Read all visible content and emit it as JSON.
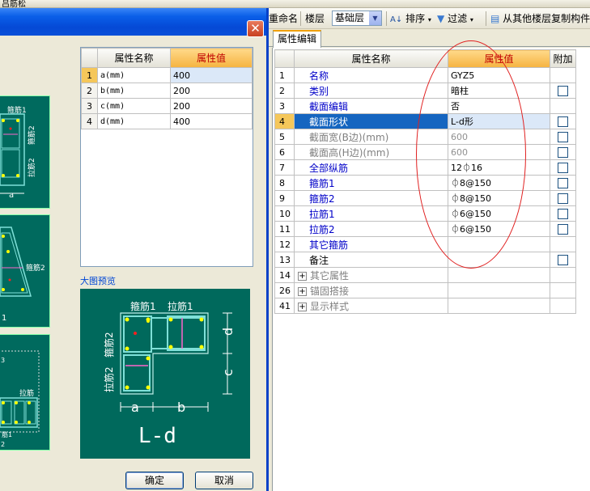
{
  "top_strip": {
    "left_text": "吕筋松"
  },
  "dialog": {
    "close_glyph": "✕",
    "thumbs": {
      "t1": {
        "label_a": "箍筋1",
        "label_b": "箍筋2",
        "label_c": "拉筋2",
        "label_d": "a"
      },
      "t2": {
        "label_a": "箍筋2",
        "label_b": "1"
      },
      "t3": {
        "label_a": "拉筋",
        "label_b": "3",
        "label_c": "筋1",
        "label_d": "2"
      }
    },
    "param_table": {
      "header": {
        "name": "属性名称",
        "value": "属性值"
      },
      "rows": [
        {
          "no": "1",
          "name": "a(mm)",
          "value": "400"
        },
        {
          "no": "2",
          "name": "b(mm)",
          "value": "200"
        },
        {
          "no": "3",
          "name": "c(mm)",
          "value": "200"
        },
        {
          "no": "4",
          "name": "d(mm)",
          "value": "400"
        }
      ]
    },
    "preview": {
      "label": "大图预览",
      "stirrup1": "箍筋1",
      "tie1": "拉筋1",
      "stirrup2": "箍筋2",
      "tie2": "拉筋2",
      "dim_a": "a",
      "dim_b": "b",
      "dim_c": "c",
      "dim_d": "d",
      "shape_name": "L-d"
    },
    "ok_label": "确定",
    "cancel_label": "取消"
  },
  "toolbar": {
    "rename": "重命名",
    "floor": "楼层",
    "floor_value": "基础层",
    "sort": "排序",
    "filter": "过滤",
    "copy_from_floor": "从其他楼层复制构件"
  },
  "tab": {
    "label": "属性编辑"
  },
  "prop_table": {
    "header": {
      "name": "属性名称",
      "value": "属性值",
      "attach": "附加"
    },
    "rows": [
      {
        "no": "1",
        "name": "名称",
        "value": "GYZ5",
        "check": false,
        "style": "blue"
      },
      {
        "no": "2",
        "name": "类别",
        "value": "暗柱",
        "check": true,
        "style": "blue"
      },
      {
        "no": "3",
        "name": "截面编辑",
        "value": "否",
        "check": false,
        "style": "blue"
      },
      {
        "no": "4",
        "name": "截面形状",
        "value": "L-d形",
        "check": true,
        "style": "blue"
      },
      {
        "no": "5",
        "name": "截面宽(B边)(mm)",
        "value": "600",
        "check": true,
        "style": "gray"
      },
      {
        "no": "6",
        "name": "截面高(H边)(mm)",
        "value": "600",
        "check": true,
        "style": "gray"
      },
      {
        "no": "7",
        "name": "全部纵筋",
        "value": "12⏀16",
        "check": true,
        "style": "blue"
      },
      {
        "no": "8",
        "name": "箍筋1",
        "value": "⏀8@150",
        "check": true,
        "style": "blue"
      },
      {
        "no": "9",
        "name": "箍筋2",
        "value": "⏀8@150",
        "check": true,
        "style": "blue"
      },
      {
        "no": "10",
        "name": "拉筋1",
        "value": "⏀6@150",
        "check": true,
        "style": "blue"
      },
      {
        "no": "11",
        "name": "拉筋2",
        "value": "⏀6@150",
        "check": true,
        "style": "blue"
      },
      {
        "no": "12",
        "name": "其它箍筋",
        "value": "",
        "check": false,
        "style": "blue"
      },
      {
        "no": "13",
        "name": "备注",
        "value": "",
        "check": true,
        "style": "black"
      }
    ],
    "groups": [
      {
        "no": "14",
        "name": "其它属性"
      },
      {
        "no": "26",
        "name": "锚固搭接"
      },
      {
        "no": "41",
        "name": "显示样式"
      }
    ],
    "plus_glyph": "+"
  },
  "colors": {
    "accent": "#f5b340",
    "selection": "#1565c0",
    "annotation": "#e02020",
    "preview_bg": "#00695c"
  }
}
